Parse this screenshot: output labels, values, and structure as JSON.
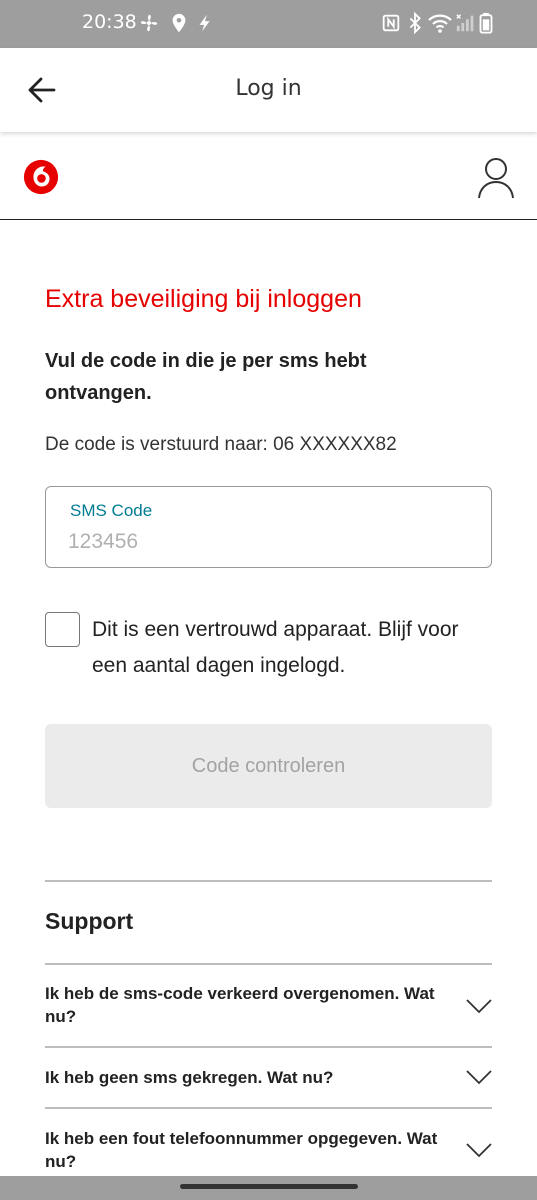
{
  "status_bar": {
    "time": "20:38",
    "left_icons": [
      "fan-icon",
      "location-icon",
      "flash-icon"
    ],
    "right_icons": [
      "nfc-icon",
      "bluetooth-icon",
      "wifi-icon",
      "signal-icon",
      "battery-icon"
    ]
  },
  "app_bar": {
    "title": "Log in",
    "back_icon": "arrow-left-icon"
  },
  "brand": {
    "logo_icon": "vodafone-logo-icon",
    "account_icon": "user-icon",
    "accent_color": "#e60000"
  },
  "main": {
    "heading": "Extra beveiliging bij inloggen",
    "instruction": "Vul de code in die je per sms hebt ontvangen.",
    "sent_to": "De code is verstuurd naar: 06 XXXXXX82",
    "sms_field": {
      "label": "SMS Code",
      "placeholder": "123456",
      "value": ""
    },
    "trusted_device": {
      "label": "Dit is een vertrouwd apparaat. Blijf voor een aantal dagen ingelogd.",
      "checked": false
    },
    "submit_label": "Code controleren"
  },
  "support": {
    "title": "Support",
    "items": [
      {
        "question": "Ik heb de sms-code verkeerd overgenomen. Wat nu?"
      },
      {
        "question": "Ik heb geen sms gekregen. Wat nu?"
      },
      {
        "question": "Ik heb een fout telefoonnummer opgegeven. Wat nu?"
      }
    ]
  }
}
